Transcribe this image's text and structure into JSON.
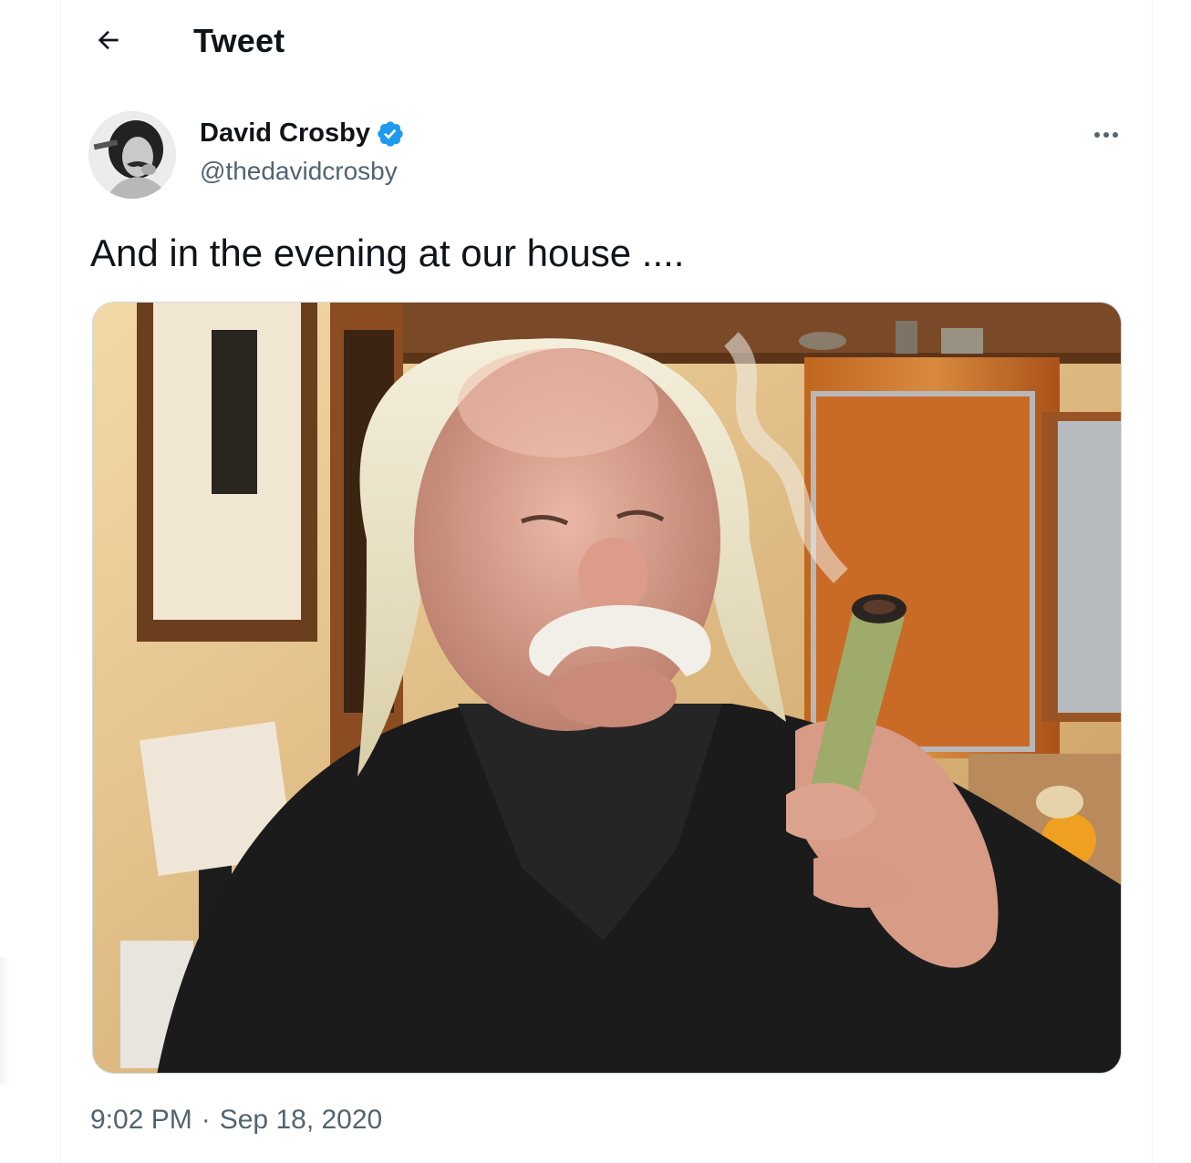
{
  "header": {
    "title": "Tweet",
    "back_icon": "arrow-left-icon"
  },
  "tweet": {
    "author": {
      "name": "David Crosby",
      "handle": "@thedavidcrosby",
      "verified": true,
      "verified_color": "#1d9bf0",
      "avatar_icon": "avatar"
    },
    "more_icon": "more-horizontal-icon",
    "text": "And in the evening at our house ....",
    "media": {
      "type": "photo",
      "description_icon": "tweet-photo"
    },
    "time": "9:02 PM",
    "separator": "·",
    "date": "Sep 18, 2020"
  },
  "colors": {
    "text_primary": "#0f1419",
    "text_secondary": "#536471",
    "border": "#cfd9de"
  }
}
